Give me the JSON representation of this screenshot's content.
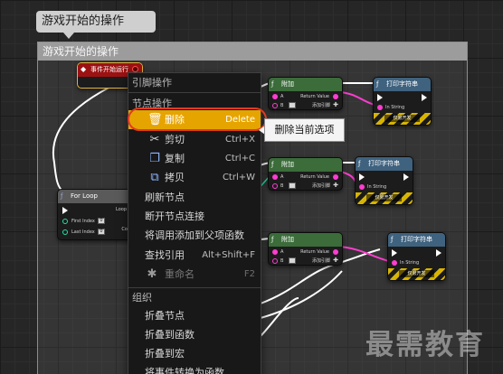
{
  "bubble": {
    "title": "游戏开始的操作"
  },
  "comment": {
    "title": "游戏开始的操作"
  },
  "event_node": {
    "title": "事件开始运行"
  },
  "forloop_node": {
    "title": "For Loop",
    "first_index_label": "First Index",
    "first_index_value": "0",
    "last_index_label": "Last Index",
    "last_index_value": "0",
    "loop_body_label": "Loop",
    "completed_label": "Comp"
  },
  "append_nodes": [
    {
      "title": "附加",
      "a_label": "A",
      "b_label": "B",
      "return_label": "Return Value",
      "add_pin_label": "添加引脚"
    },
    {
      "title": "附加",
      "a_label": "A",
      "b_label": "B",
      "return_label": "Return Value",
      "add_pin_label": "添加引脚"
    },
    {
      "title": "附加",
      "a_label": "A",
      "b_label": "B",
      "return_label": "Return Value",
      "add_pin_label": "添加引脚"
    }
  ],
  "print_nodes": [
    {
      "title": "打印字符串",
      "in_string_label": "In String",
      "dev_only_label": "仅限开发"
    },
    {
      "title": "打印字符串",
      "in_string_label": "In String",
      "dev_only_label": "仅限开发"
    },
    {
      "title": "打印字符串",
      "in_string_label": "In String",
      "dev_only_label": "仅限开发"
    }
  ],
  "context_menu": {
    "section_pin": "引脚操作",
    "section_node": "节点操作",
    "items": [
      {
        "label": "删除",
        "shortcut": "Delete",
        "icon": "trash-icon"
      },
      {
        "label": "剪切",
        "shortcut": "Ctrl+X",
        "icon": "scissors-icon"
      },
      {
        "label": "复制",
        "shortcut": "Ctrl+C",
        "icon": "copy-icon"
      },
      {
        "label": "拷贝",
        "shortcut": "Ctrl+W",
        "icon": "duplicate-icon"
      }
    ],
    "refresh": "刷新节点",
    "break_links": "断开节点连接",
    "add_call_parent": "将调用添加到父项函数",
    "find_refs": "查找引用",
    "find_refs_shortcut": "Alt+Shift+F",
    "rename": "重命名",
    "rename_shortcut": "F2",
    "section_organize": "组织",
    "collapse_nodes": "折叠节点",
    "collapse_function": "折叠到函数",
    "collapse_macro": "折叠到宏",
    "convert_event": "将事件转换为函数"
  },
  "tooltip": {
    "text": "删除当前选项"
  },
  "watermark": {
    "text": "最需教育"
  },
  "colors": {
    "highlight": "#e6a400",
    "annotation_ring": "#e23b22",
    "event_header": "#9c1212",
    "function_header": "#3b6c3a",
    "print_header": "#3f627f",
    "string_pin": "#ff3dd0",
    "int_pin": "#23e0a7"
  }
}
